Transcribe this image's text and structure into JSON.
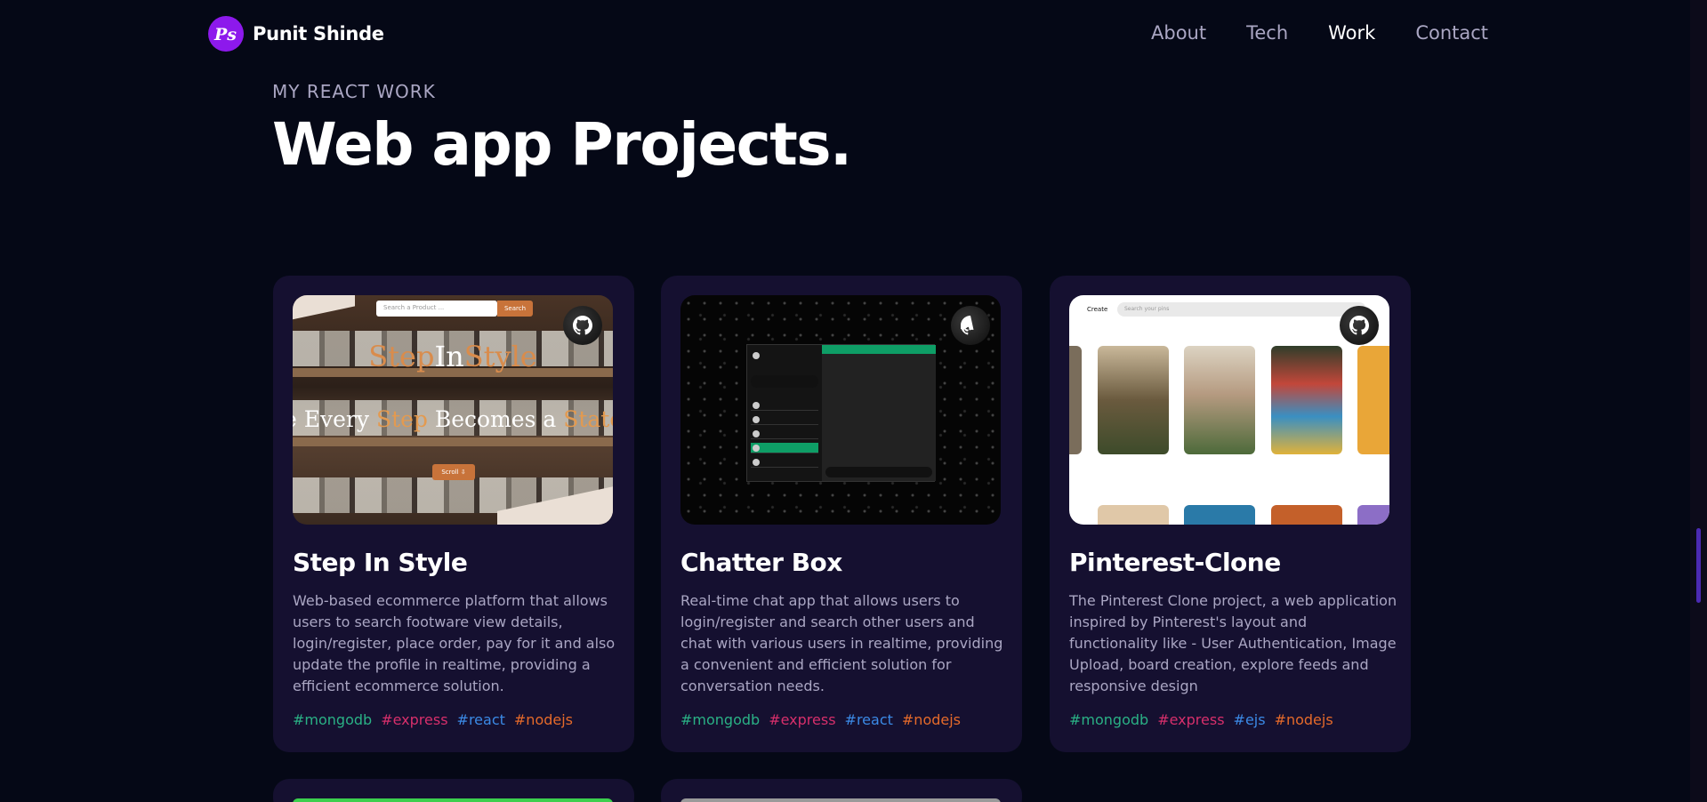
{
  "nav": {
    "brand_name": "Punit Shinde",
    "logo_text": "Ps",
    "links": [
      "About",
      "Tech",
      "Work",
      "Contact"
    ],
    "active": "Work"
  },
  "section": {
    "subtitle": "MY REACT WORK",
    "title": "Web app Projects."
  },
  "projects": [
    {
      "name": "Step In Style",
      "description": "Web-based ecommerce platform that allows users to search footware view details, login/register, place order, pay for it and also update the profile in realtime, providing a efficient ecommerce solution.",
      "tags": [
        "#mongodb",
        "#express",
        "#react",
        "#nodejs"
      ],
      "thumb": {
        "search_placeholder": "Search a Product ...",
        "search_button": "Search",
        "brand_a": "Step",
        "brand_b": "In",
        "brand_c": "Style",
        "tagline_a": "e Every ",
        "tagline_b": "Step",
        "tagline_c": " Becomes a ",
        "tagline_d": "State",
        "scroll_button": "Scroll ⇩"
      }
    },
    {
      "name": "Chatter Box",
      "description": "Real-time chat app that allows users to login/register and search other users and chat with various users in realtime, providing a convenient and efficient solution for conversation needs.",
      "tags": [
        "#mongodb",
        "#express",
        "#react",
        "#nodejs"
      ]
    },
    {
      "name": "Pinterest-Clone",
      "description": "The Pinterest Clone project, a web application inspired by Pinterest's layout and functionality like - User Authentication, Image Upload, board creation, explore feeds and responsive design",
      "tags": [
        "#mongodb",
        "#express",
        "#ejs",
        "#nodejs"
      ],
      "thumb": {
        "create_label": "Create",
        "search_placeholder": "Search your pins"
      }
    }
  ],
  "colors": {
    "background": "#050816",
    "card": "#151030",
    "accent": "#8d19ec",
    "muted_text": "#aaa6c3",
    "tag_green": "#2ab185",
    "tag_pink": "#d72f6b",
    "tag_blue": "#3b8ae6",
    "tag_orange": "#e56a2a"
  },
  "icons": {
    "github": "github-icon"
  }
}
